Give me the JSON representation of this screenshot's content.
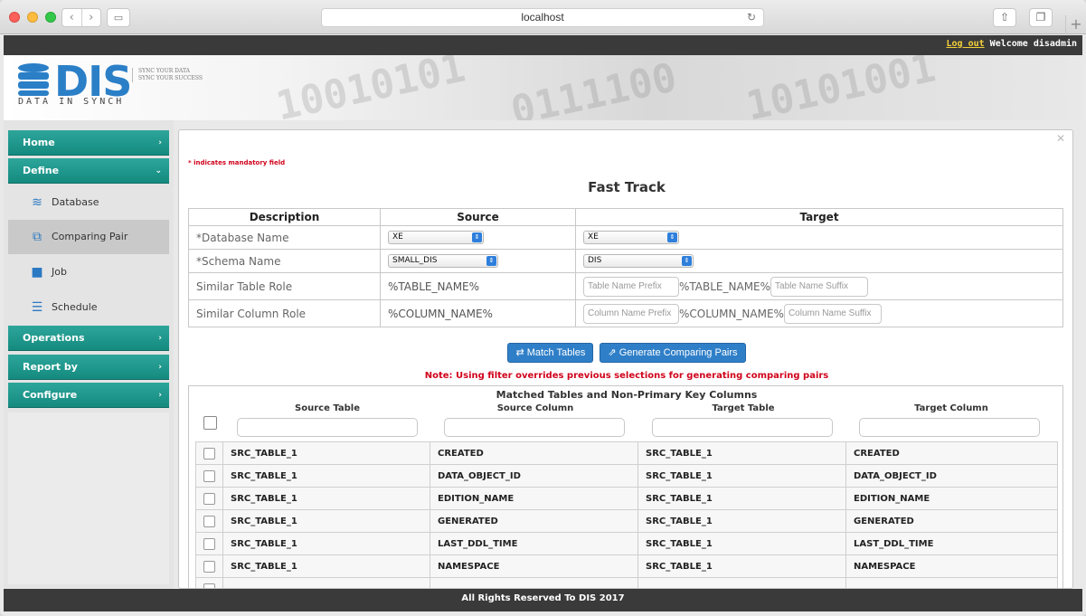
{
  "browser": {
    "url": "localhost",
    "reload_icon": "↻",
    "back_icon": "‹",
    "forward_icon": "›"
  },
  "topbar": {
    "logout": "Log out",
    "welcome": "Welcome disadmin"
  },
  "logo": {
    "name": "DIS",
    "subtitle": "DATA IN SYNCH",
    "tagline_1": "SYNC YOUR DATA",
    "tagline_2": "SYNC YOUR SUCCESS"
  },
  "sidebar": {
    "items": [
      {
        "label": "Home",
        "arrow": "›"
      },
      {
        "label": "Define",
        "arrow": "⌄"
      },
      {
        "label": "Operations",
        "arrow": "›"
      },
      {
        "label": "Report by",
        "arrow": "›"
      },
      {
        "label": "Configure",
        "arrow": "›"
      }
    ],
    "sub": [
      {
        "label": "Database",
        "icon": "database-icon"
      },
      {
        "label": "Comparing Pair",
        "icon": "compare-icon"
      },
      {
        "label": "Job",
        "icon": "briefcase-icon"
      },
      {
        "label": "Schedule",
        "icon": "list-icon"
      }
    ]
  },
  "form": {
    "mandatory_note": "* indicates mandatory field",
    "title": "Fast Track",
    "headers": [
      "Description",
      "Source",
      "Target"
    ],
    "rows": {
      "database_name_label": "*Database Name",
      "schema_name_label": "*Schema Name",
      "similar_table_label": "Similar Table Role",
      "similar_column_label": "Similar Column Role"
    },
    "source_database": "XE",
    "target_database": "XE",
    "source_schema": "SMALL_DIS",
    "target_schema": "DIS",
    "source_table_role": "%TABLE_NAME%",
    "source_column_role": "%COLUMN_NAME%",
    "target_table_mid": "%TABLE_NAME%",
    "target_column_mid": "%COLUMN_NAME%",
    "table_prefix_placeholder": "Table Name Prefix",
    "table_suffix_placeholder": "Table Name Suffix",
    "column_prefix_placeholder": "Column Name Prefix",
    "column_suffix_placeholder": "Column Name Suffix",
    "match_tables_btn": "Match Tables",
    "generate_pairs_btn": "Generate Comparing Pairs",
    "note": "Note: Using filter overrides previous selections for generating comparing pairs"
  },
  "matched": {
    "title": "Matched Tables and Non-Primary Key Columns",
    "columns": [
      "Source Table",
      "Source Column",
      "Target Table",
      "Target Column"
    ],
    "rows": [
      [
        "SRC_TABLE_1",
        "CREATED",
        "SRC_TABLE_1",
        "CREATED"
      ],
      [
        "SRC_TABLE_1",
        "DATA_OBJECT_ID",
        "SRC_TABLE_1",
        "DATA_OBJECT_ID"
      ],
      [
        "SRC_TABLE_1",
        "EDITION_NAME",
        "SRC_TABLE_1",
        "EDITION_NAME"
      ],
      [
        "SRC_TABLE_1",
        "GENERATED",
        "SRC_TABLE_1",
        "GENERATED"
      ],
      [
        "SRC_TABLE_1",
        "LAST_DDL_TIME",
        "SRC_TABLE_1",
        "LAST_DDL_TIME"
      ],
      [
        "SRC_TABLE_1",
        "NAMESPACE",
        "SRC_TABLE_1",
        "NAMESPACE"
      ]
    ]
  },
  "footer": {
    "text": "All Rights Reserved To DIS 2017"
  },
  "colors": {
    "accent": "#158b80",
    "brand_blue": "#2b7fc7",
    "button_blue": "#2f7fc8",
    "error_red": "#d0021b"
  }
}
